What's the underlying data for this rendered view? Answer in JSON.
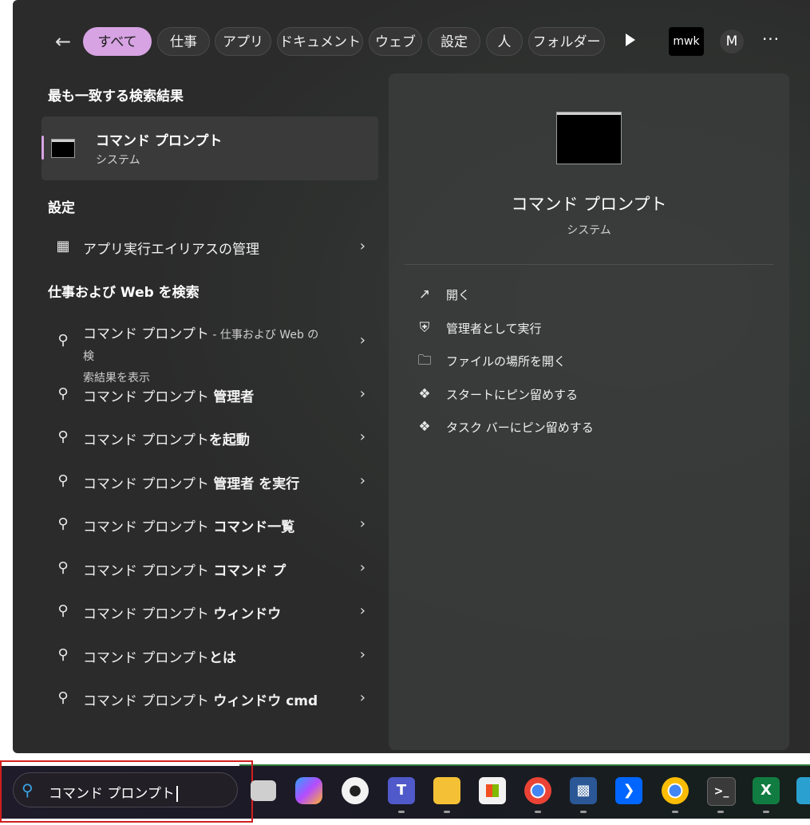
{
  "filters": {
    "back_icon": "arrow-left-icon",
    "chips": [
      "すべて",
      "仕事",
      "アプリ",
      "ドキュメント",
      "ウェブ",
      "設定",
      "人",
      "フォルダー"
    ],
    "active_index": 0,
    "org_label": "mwk",
    "avatar_label": "M",
    "more_label": "···"
  },
  "best_match": {
    "heading": "最も一致する検索結果",
    "title": "コマンド プロンプト",
    "subtitle": "システム"
  },
  "settings": {
    "heading": "設定",
    "item": "アプリ実行エイリアスの管理"
  },
  "web": {
    "heading": "仕事および Web を検索",
    "first_title": "コマンド プロンプト",
    "first_suffix": " - 仕事および Web の検",
    "first_suffix2": "索結果を表示",
    "items": [
      {
        "prefix": "コマンド プロンプト ",
        "bold": "管理者"
      },
      {
        "prefix": "コマンド プロンプト",
        "bold": "を起動"
      },
      {
        "prefix": "コマンド プロンプト ",
        "bold": "管理者 を実行"
      },
      {
        "prefix": "コマンド プロンプト ",
        "bold": "コマンド一覧"
      },
      {
        "prefix": "コマンド プロンプト ",
        "bold": "コマンド プ"
      },
      {
        "prefix": "コマンド プロンプト ",
        "bold": "ウィンドウ"
      },
      {
        "prefix": "コマンド プロンプト",
        "bold": "とは"
      },
      {
        "prefix": "コマンド プロンプト ",
        "bold": "ウィンドウ cmd"
      }
    ]
  },
  "preview": {
    "title": "コマンド プロンプト",
    "subtitle": "システム",
    "actions": [
      "開く",
      "管理者として実行",
      "ファイルの場所を開く",
      "スタートにピン留めする",
      "タスク バーにピン留めする"
    ]
  },
  "taskbar": {
    "search_text": "コマンド プロンプト",
    "apps": [
      "task-view-icon",
      "copilot-icon",
      "penguin-app-icon",
      "teams-icon",
      "file-explorer-icon",
      "microsoft-store-icon",
      "chrome-icon",
      "remote-desktop-icon",
      "power-automate-icon",
      "chrome-dev-icon",
      "terminal-icon",
      "excel-icon",
      "extra-app-icon"
    ]
  }
}
